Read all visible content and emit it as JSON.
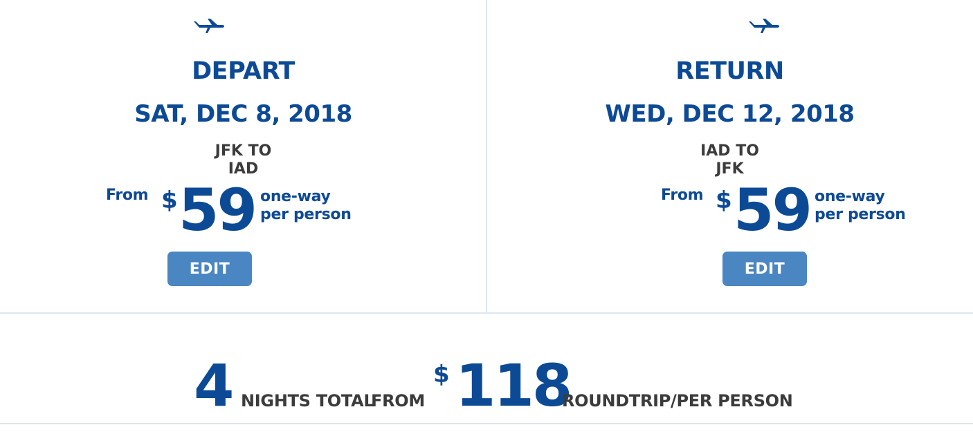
{
  "colors": {
    "brand_blue": "#0d4a96",
    "button_blue": "#4a86c2",
    "text_gray": "#3b3b3b",
    "divider": "#dbe7f0"
  },
  "depart": {
    "icon": "airplane-icon",
    "heading": "DEPART",
    "date": "SAT, DEC 8, 2018",
    "route_line1": "JFK TO",
    "route_line2": "IAD",
    "from_label": "From",
    "currency": "$",
    "price": "59",
    "unit_line1": "one-way",
    "unit_line2": "per person",
    "edit_label": "EDIT"
  },
  "return": {
    "icon": "airplane-icon",
    "heading": "RETURN",
    "date": "WED, DEC 12, 2018",
    "route_line1": "IAD TO",
    "route_line2": "JFK",
    "from_label": "From",
    "currency": "$",
    "price": "59",
    "unit_line1": "one-way",
    "unit_line2": "per person",
    "edit_label": "EDIT"
  },
  "summary": {
    "nights": "4",
    "nights_label": "NIGHTS TOTAL",
    "from_label": "FROM",
    "currency": "$",
    "total_price": "118",
    "unit_label": "ROUNDTRIP/PER PERSON"
  }
}
